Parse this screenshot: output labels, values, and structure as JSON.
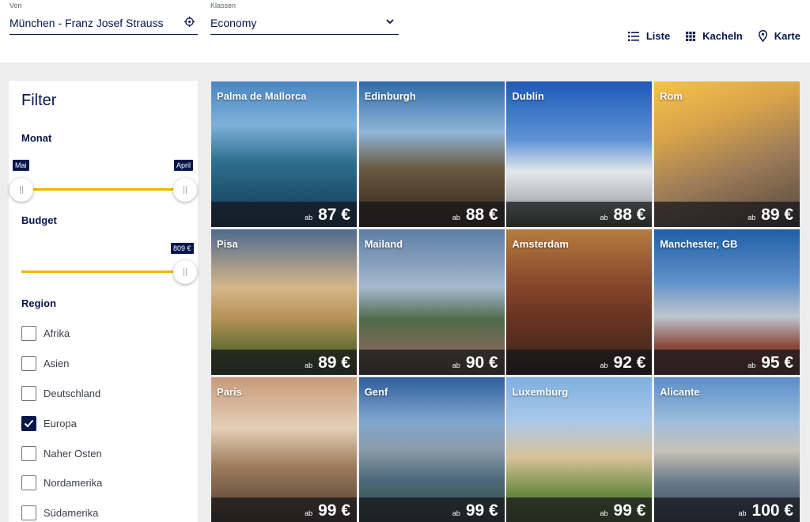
{
  "header": {
    "from_label": "Von",
    "from_value": "München - Franz Josef Strauss",
    "class_label": "Klassen",
    "class_value": "Economy",
    "views": [
      {
        "label": "Liste",
        "icon": "list-icon"
      },
      {
        "label": "Kacheln",
        "icon": "grid-icon"
      },
      {
        "label": "Karte",
        "icon": "map-pin-icon"
      }
    ]
  },
  "filter": {
    "title": "Filter",
    "month": {
      "title": "Monat",
      "from": "Mai",
      "to": "April"
    },
    "budget": {
      "title": "Budget",
      "value": "809 €"
    },
    "region": {
      "title": "Region",
      "items": [
        {
          "label": "Afrika",
          "checked": false
        },
        {
          "label": "Asien",
          "checked": false
        },
        {
          "label": "Deutschland",
          "checked": false
        },
        {
          "label": "Europa",
          "checked": true
        },
        {
          "label": "Naher Osten",
          "checked": false
        },
        {
          "label": "Nordamerika",
          "checked": false
        },
        {
          "label": "Südamerika",
          "checked": false
        }
      ]
    }
  },
  "colors": {
    "brand": "#05164d",
    "accent": "#f0b400"
  },
  "destinations": [
    {
      "city": "Palma de Mallorca",
      "prefix": "ab",
      "price": "87 €"
    },
    {
      "city": "Edinburgh",
      "prefix": "ab",
      "price": "88 €"
    },
    {
      "city": "Dublin",
      "prefix": "ab",
      "price": "88 €"
    },
    {
      "city": "Rom",
      "prefix": "ab",
      "price": "89 €"
    },
    {
      "city": "Pisa",
      "prefix": "ab",
      "price": "89 €"
    },
    {
      "city": "Mailand",
      "prefix": "ab",
      "price": "90 €"
    },
    {
      "city": "Amsterdam",
      "prefix": "ab",
      "price": "92 €"
    },
    {
      "city": "Manchester, GB",
      "prefix": "ab",
      "price": "95 €"
    },
    {
      "city": "Paris",
      "prefix": "ab",
      "price": "99 €"
    },
    {
      "city": "Genf",
      "prefix": "ab",
      "price": "99 €"
    },
    {
      "city": "Luxemburg",
      "prefix": "ab",
      "price": "99 €"
    },
    {
      "city": "Alicante",
      "prefix": "ab",
      "price": "100 €"
    }
  ]
}
